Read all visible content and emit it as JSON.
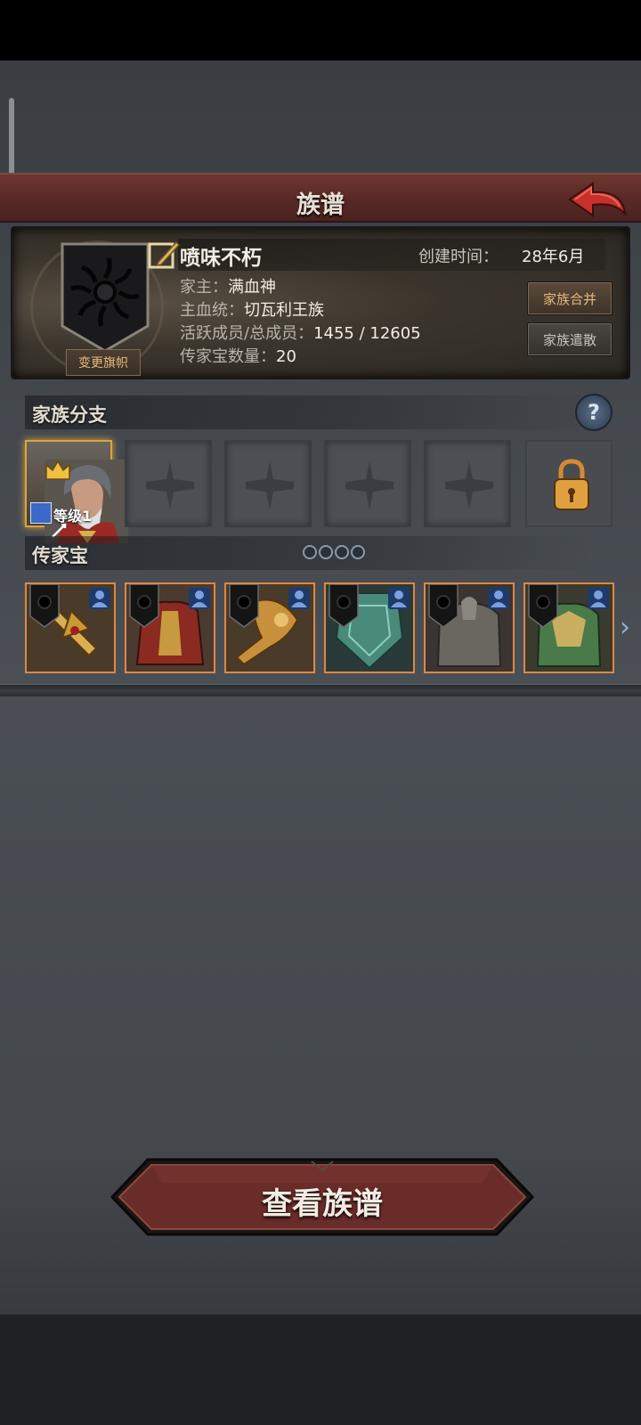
{
  "title": "族谱",
  "clan": {
    "name": "喷味不朽",
    "created_label": "创建时间：",
    "created_value": "28年6月",
    "leader_label": "家主：",
    "leader_value": "满血神",
    "bloodline_label": "主血统：",
    "bloodline_value": "切瓦利王族",
    "members_label": "活跃成员/总成员：",
    "members_value": "1455 / 12605",
    "heirloom_count_label": "传家宝数量：",
    "heirloom_count_value": "20",
    "change_banner_label": "变更旗帜",
    "merge_label": "家族合并",
    "disband_label": "家族遣散"
  },
  "branches": {
    "title": "家族分支",
    "help_label": "?",
    "level_label": "等级1",
    "empty_slots": 4,
    "locked_slots": 1
  },
  "heirlooms": {
    "title": "传家宝",
    "page_count": 4,
    "items": [
      {
        "icon": "golden-cross-weapon"
      },
      {
        "icon": "red-gold-armor"
      },
      {
        "icon": "golden-ornate-staff"
      },
      {
        "icon": "jade-shield"
      },
      {
        "icon": "silver-plate-armor"
      },
      {
        "icon": "emerald-plate-armor"
      }
    ]
  },
  "view_tree_label": "查看族谱",
  "colors": {
    "title_bar": "#5a2a27",
    "accent_orange": "#e08840",
    "gold": "#d8a640"
  }
}
